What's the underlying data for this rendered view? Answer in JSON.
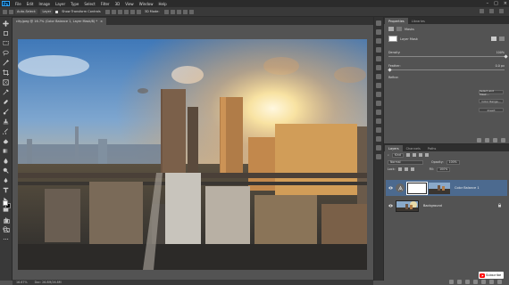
{
  "app": {
    "logo": "Ps"
  },
  "menu": [
    "File",
    "Edit",
    "Image",
    "Layer",
    "Type",
    "Select",
    "Filter",
    "3D",
    "View",
    "Window",
    "Help"
  ],
  "options": {
    "sample_label": "Auto-Select:",
    "layer_value": "Layer",
    "transform_label": "Show Transform Controls",
    "mode_label": "3D Mode:"
  },
  "document": {
    "tab_title": "city.jpeg @ 16.7% (Color Balance 1, Layer Mask/8) *",
    "zoom": "16.67%",
    "doc_size": "Doc: 26.8M/26.8M"
  },
  "properties": {
    "tabs": [
      "Properties",
      "Libraries"
    ],
    "section_title": "Masks",
    "mask_label": "Layer Mask",
    "density_label": "Density:",
    "density_value": "100%",
    "feather_label": "Feather:",
    "feather_value": "0.0 px",
    "refine_label": "Refine:",
    "select_mask_btn": "Select and Mask...",
    "color_range_btn": "Color Range...",
    "invert_btn": "Invert"
  },
  "layers": {
    "tabs": [
      "Layers",
      "Channels",
      "Paths"
    ],
    "kind_label": "Kind",
    "blend_mode": "Normal",
    "opacity_label": "Opacity:",
    "opacity_value": "100%",
    "lock_label": "Lock:",
    "fill_label": "Fill:",
    "fill_value": "100%",
    "items": [
      {
        "name": "Color Balance 1",
        "selected": true
      },
      {
        "name": "Background",
        "selected": false
      }
    ]
  },
  "badge": {
    "label": "Subscribe"
  },
  "colors": {
    "accent": "#31a8ff",
    "selection": "#4c6a8f"
  }
}
